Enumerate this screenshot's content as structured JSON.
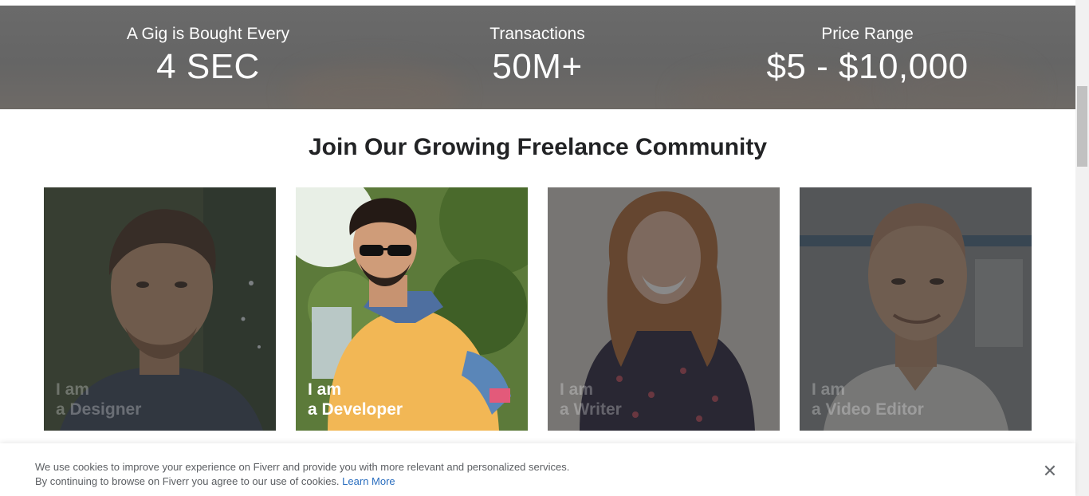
{
  "stats": [
    {
      "label": "A Gig is Bought Every",
      "value": "4 SEC"
    },
    {
      "label": "Transactions",
      "value": "50M+"
    },
    {
      "label": "Price Range",
      "value": "$5 - $10,000"
    }
  ],
  "community": {
    "title": "Join Our Growing Freelance Community",
    "cards": [
      {
        "line1": "I am",
        "line2": "a Designer",
        "active": false
      },
      {
        "line1": "I am",
        "line2": "a Developer",
        "active": true
      },
      {
        "line1": "I am",
        "line2": "a Writer",
        "active": false
      },
      {
        "line1": "I am",
        "line2": "a Video Editor",
        "active": false
      }
    ]
  },
  "cookie_banner": {
    "line1": "We use cookies to improve your experience on Fiverr and provide you with more relevant and personalized services.",
    "line2": "By continuing to browse on Fiverr you agree to our use of cookies.",
    "link": "Learn More",
    "close_icon": "close-icon"
  },
  "colors": {
    "stats_band": "#666666",
    "link": "#2a6ebf",
    "title": "#222325"
  }
}
